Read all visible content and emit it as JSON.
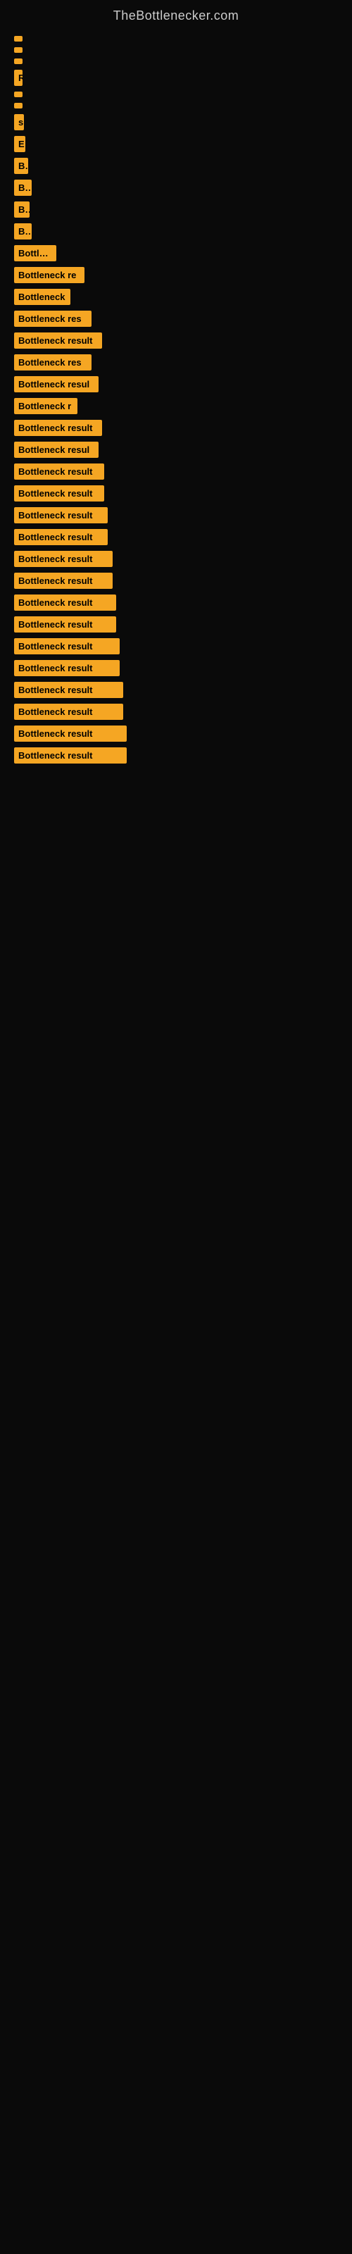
{
  "site": {
    "title": "TheBottlenecker.com"
  },
  "bars": [
    {
      "label": "",
      "width": 8
    },
    {
      "label": "",
      "width": 10
    },
    {
      "label": "",
      "width": 10
    },
    {
      "label": "R",
      "width": 12
    },
    {
      "label": "",
      "width": 10
    },
    {
      "label": "",
      "width": 10
    },
    {
      "label": "s",
      "width": 14
    },
    {
      "label": "E",
      "width": 16
    },
    {
      "label": "Bo",
      "width": 20
    },
    {
      "label": "Bot",
      "width": 25
    },
    {
      "label": "Bo",
      "width": 22
    },
    {
      "label": "Bot",
      "width": 25
    },
    {
      "label": "Bottlene",
      "width": 60
    },
    {
      "label": "Bottleneck re",
      "width": 100
    },
    {
      "label": "Bottleneck",
      "width": 80
    },
    {
      "label": "Bottleneck res",
      "width": 110
    },
    {
      "label": "Bottleneck result",
      "width": 125
    },
    {
      "label": "Bottleneck res",
      "width": 110
    },
    {
      "label": "Bottleneck resul",
      "width": 120
    },
    {
      "label": "Bottleneck r",
      "width": 90
    },
    {
      "label": "Bottleneck result",
      "width": 125
    },
    {
      "label": "Bottleneck resul",
      "width": 120
    },
    {
      "label": "Bottleneck result",
      "width": 128
    },
    {
      "label": "Bottleneck result",
      "width": 128
    },
    {
      "label": "Bottleneck result",
      "width": 133
    },
    {
      "label": "Bottleneck result",
      "width": 133
    },
    {
      "label": "Bottleneck result",
      "width": 140
    },
    {
      "label": "Bottleneck result",
      "width": 140
    },
    {
      "label": "Bottleneck result",
      "width": 145
    },
    {
      "label": "Bottleneck result",
      "width": 145
    },
    {
      "label": "Bottleneck result",
      "width": 150
    },
    {
      "label": "Bottleneck result",
      "width": 150
    },
    {
      "label": "Bottleneck result",
      "width": 155
    },
    {
      "label": "Bottleneck result",
      "width": 155
    },
    {
      "label": "Bottleneck result",
      "width": 160
    },
    {
      "label": "Bottleneck result",
      "width": 160
    }
  ]
}
